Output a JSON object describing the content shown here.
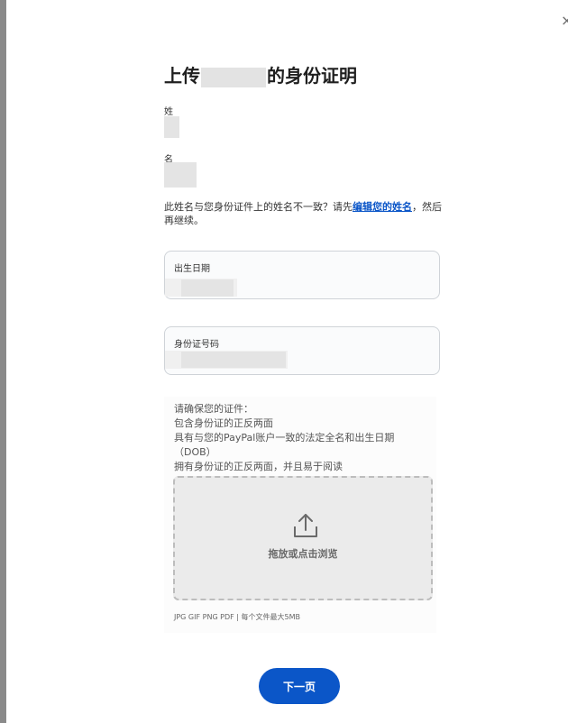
{
  "dialog": {
    "close_glyph": "×",
    "title_prefix": "上传",
    "title_suffix": "的身份证明"
  },
  "name": {
    "last_name_label": "姓",
    "first_name_label": "名"
  },
  "notice": {
    "text_before": "此姓名与您身份证件上的姓名不一致？请先",
    "link": "编辑您的姓名",
    "text_after": "，然后再继续。"
  },
  "fields": {
    "dob_label": "出生日期",
    "id_label": "身份证号码"
  },
  "instructions": {
    "heading": "请确保您的证件：",
    "items": [
      "包含身份证的正反两面",
      "具有与您的PayPal账户一致的法定全名和出生日期",
      "（DOB）",
      "拥有身份证的正反两面，并且易于阅读"
    ]
  },
  "upload": {
    "icon": "upload-icon",
    "label": "拖放或点击浏览",
    "file_note": "JPG GIF PNG PDF | 每个文件最大5MB"
  },
  "actions": {
    "next_label": "下一页"
  },
  "colors": {
    "primary": "#0b56c8",
    "link": "#0b56c8"
  }
}
